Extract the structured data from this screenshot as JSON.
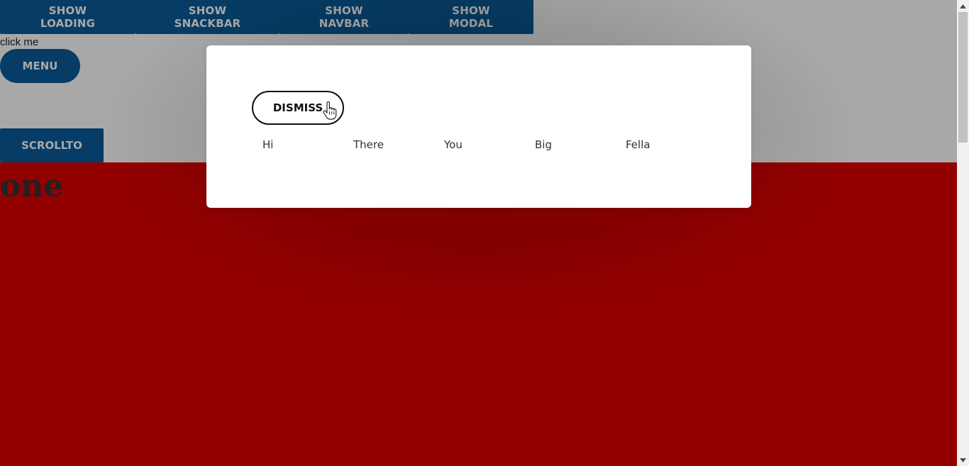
{
  "top_buttons": {
    "show_loading": "SHOW LOADING",
    "show_snackbar": "SHOW SNACKBAR",
    "show_navbar": "SHOW NAVBAR",
    "show_modal": "SHOW MODAL"
  },
  "click_me_text": "click me",
  "menu_label": "MENU",
  "scrollto_label": "SCROLLTO",
  "section_one_title": "one",
  "modal": {
    "dismiss_label": "DISMISS",
    "words": [
      "Hi",
      "There",
      "You",
      "Big",
      "Fella"
    ]
  },
  "colors": {
    "primary_button": "#0a5c9a",
    "section_background": "#e00000",
    "backdrop": "rgba(0,0,0,0.34)"
  },
  "icons": {
    "cursor": "hand-pointer-icon",
    "scroll_up": "triangle-up-icon",
    "scroll_down": "triangle-down-icon"
  }
}
